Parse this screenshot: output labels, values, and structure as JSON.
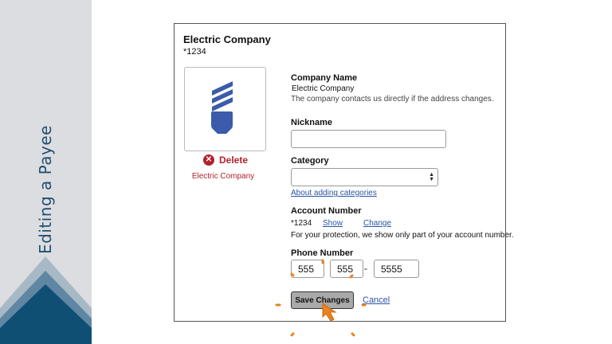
{
  "slide": {
    "title": "Editing a Payee"
  },
  "payee": {
    "name": "Electric Company",
    "account_masked": "*1234",
    "icon": "light-bulb-icon"
  },
  "delete": {
    "label": "Delete",
    "payee_name": "Electric Company",
    "icon": "close-circle-icon"
  },
  "company_name": {
    "label": "Company Name",
    "value": "Electric Company",
    "help": "The company contacts us directly if the address changes."
  },
  "nickname": {
    "label": "Nickname",
    "value": ""
  },
  "category": {
    "label": "Category",
    "value": "",
    "link": "About adding categories"
  },
  "account_number": {
    "label": "Account Number",
    "value": "*1234",
    "show_link": "Show",
    "change_link": "Change",
    "help": "For your protection, we show only part of your account number."
  },
  "phone_number": {
    "label": "Phone Number",
    "area": "555",
    "prefix": "555",
    "separator": "-",
    "line": "5555"
  },
  "actions": {
    "save_label": "Save Changes",
    "cancel_label": "Cancel"
  },
  "colors": {
    "accent_blue": "#3b5bab",
    "delete_red": "#b3212d",
    "slide_navy": "#1f4f72",
    "click_orange": "#e9821f"
  }
}
